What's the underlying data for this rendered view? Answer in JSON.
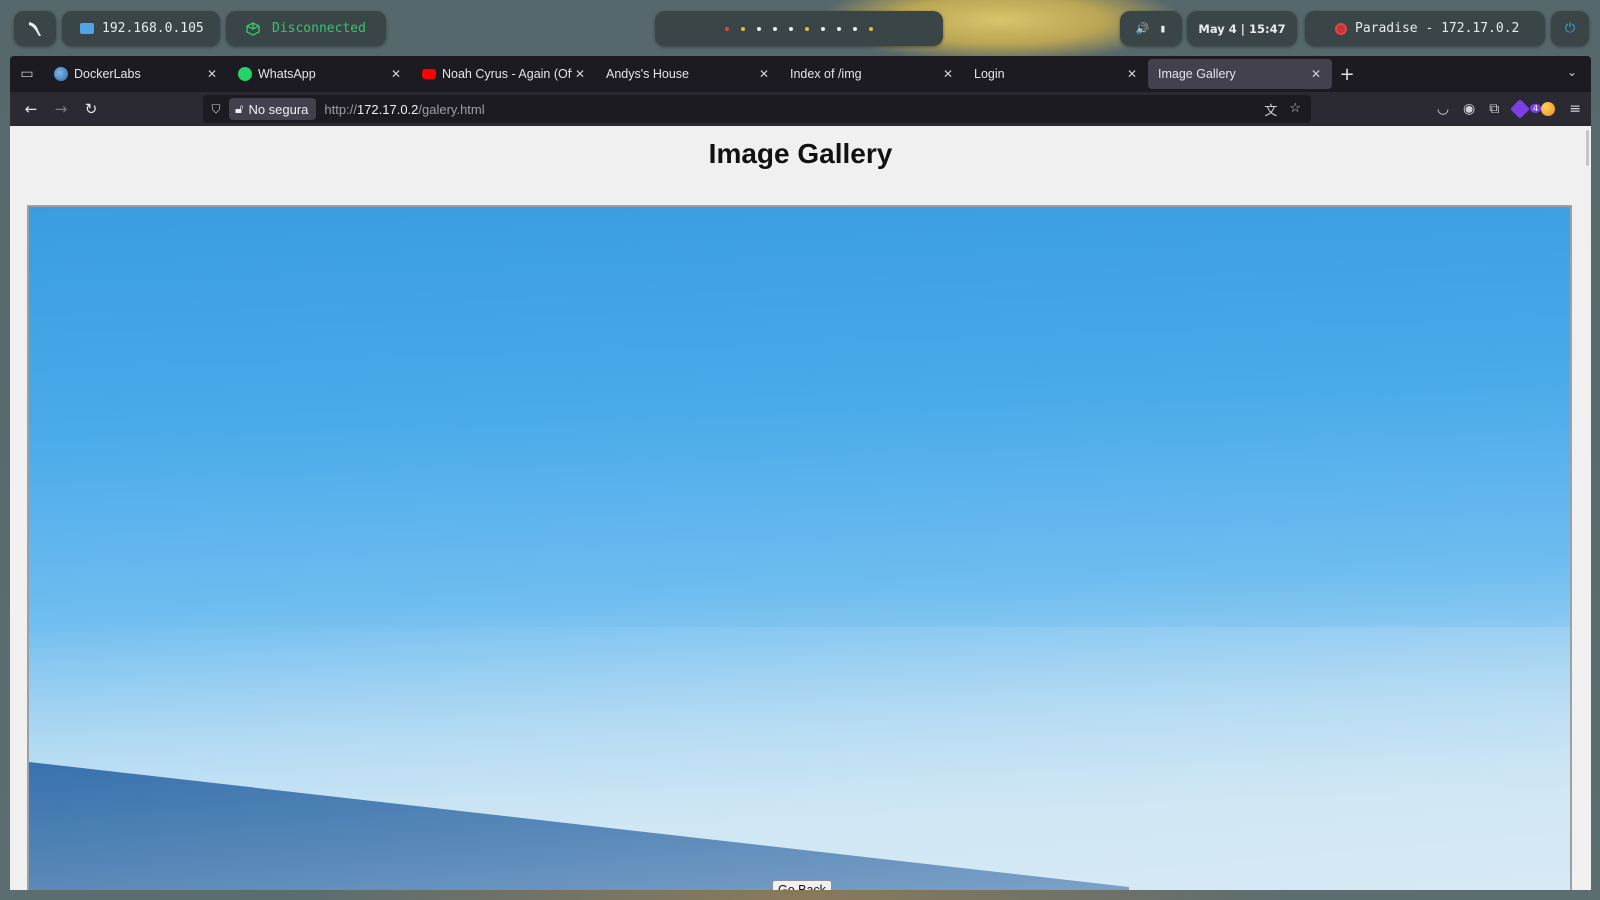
{
  "panel": {
    "local_ip": "192.168.0.105",
    "vpn_status": "Disconnected",
    "workspace_count": 10,
    "date": "May 4",
    "time": "15:47",
    "target": "Paradise - 172.17.0.2",
    "colors": {
      "vpn": "#34c76a",
      "target_icon": "#e24545",
      "accent": "#4ea6e8"
    }
  },
  "browser": {
    "tabs": [
      {
        "title": "DockerLabs",
        "icon": "docker-icon"
      },
      {
        "title": "WhatsApp",
        "icon": "whatsapp-icon"
      },
      {
        "title": "Noah Cyrus - Again (Offic",
        "icon": "youtube-icon"
      },
      {
        "title": "Andys's House",
        "icon": ""
      },
      {
        "title": "Index of /img",
        "icon": ""
      },
      {
        "title": "Login",
        "icon": ""
      },
      {
        "title": "Image Gallery",
        "icon": "",
        "active": true
      }
    ],
    "security_label": "No segura",
    "url_prefix": "http://",
    "url_host": "172.17.0.2",
    "url_path": "/galery.html",
    "extension_badge": "4"
  },
  "page": {
    "title": "Image Gallery",
    "go_back_label": "Go Back"
  }
}
